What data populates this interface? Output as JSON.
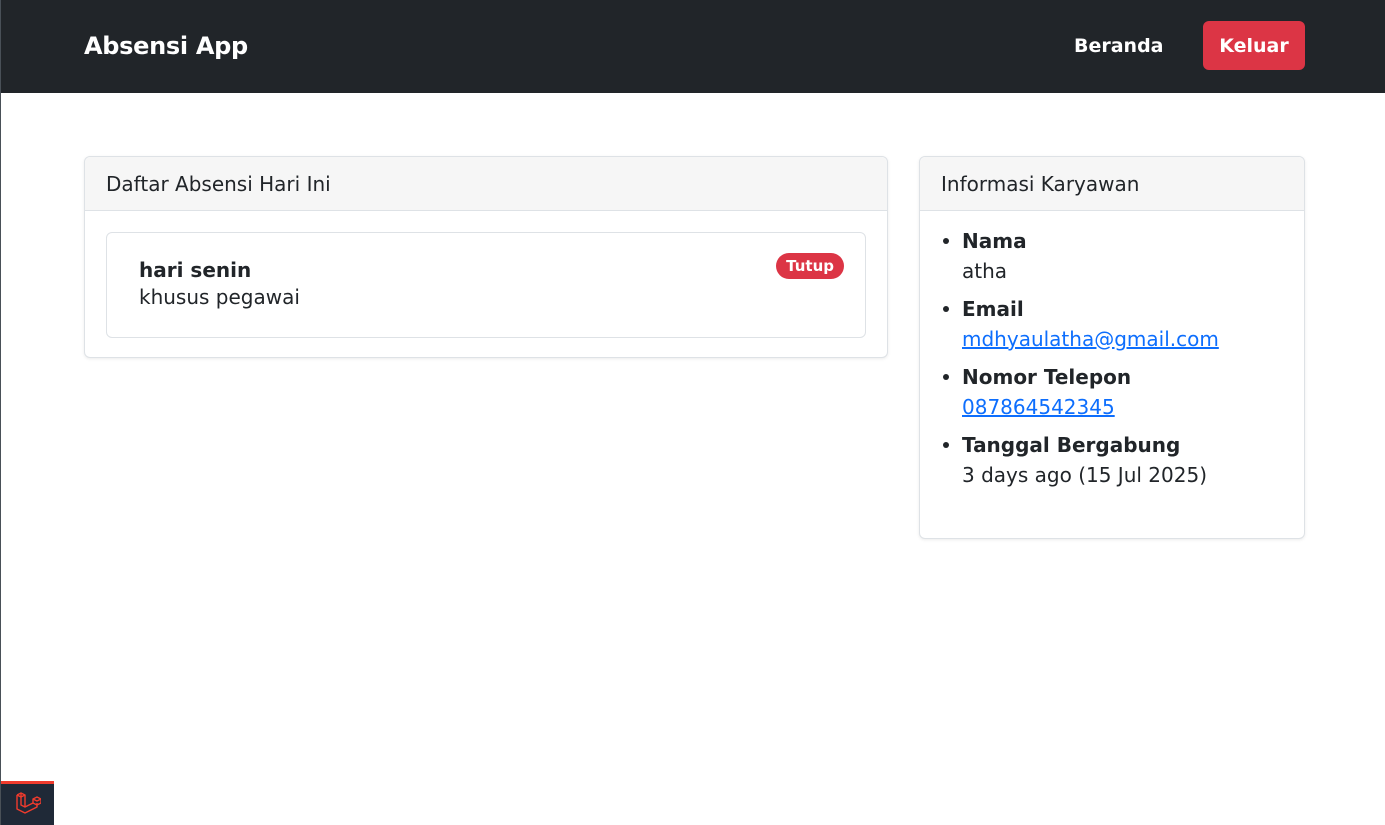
{
  "navbar": {
    "brand": "Absensi App",
    "home_label": "Beranda",
    "logout_label": "Keluar"
  },
  "attendance_card": {
    "header": "Daftar Absensi Hari Ini",
    "items": [
      {
        "title": "hari senin",
        "description": "khusus pegawai",
        "status": "Tutup"
      }
    ]
  },
  "employee_card": {
    "header": "Informasi Karyawan",
    "fields": [
      {
        "label": "Nama",
        "value": "atha"
      },
      {
        "label": "Email",
        "value": "mdhyaulatha@gmail.com"
      },
      {
        "label": "Nomor Telepon",
        "value": "087864542345"
      },
      {
        "label": "Tanggal Bergabung",
        "value": "3 days ago (15 Jul 2025)"
      }
    ]
  },
  "colors": {
    "navbar_bg": "#212529",
    "danger": "#dc3545",
    "link": "#0d6efd"
  },
  "icons": {
    "dev_toolbar": "laravel-logo-icon"
  }
}
